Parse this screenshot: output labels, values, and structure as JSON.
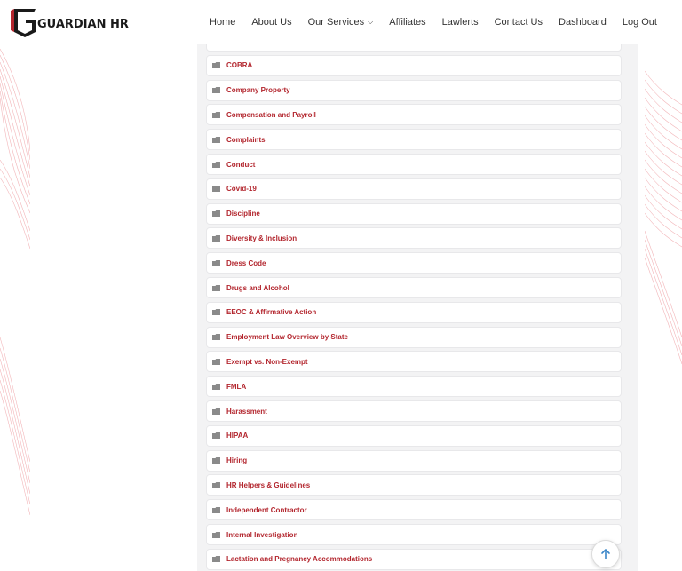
{
  "brand": {
    "name": "GUARDIAN HR",
    "accent_color": "#b3262e"
  },
  "nav": {
    "items": [
      {
        "label": "Home"
      },
      {
        "label": "About Us"
      },
      {
        "label": "Our Services",
        "has_dropdown": true
      },
      {
        "label": "Affiliates"
      },
      {
        "label": "Lawlerts"
      },
      {
        "label": "Contact Us"
      },
      {
        "label": "Dashboard"
      },
      {
        "label": "Log Out"
      }
    ]
  },
  "topics": {
    "icon": "folder-icon",
    "items": [
      {
        "label": ""
      },
      {
        "label": "COBRA"
      },
      {
        "label": "Company Property"
      },
      {
        "label": "Compensation and Payroll"
      },
      {
        "label": "Complaints"
      },
      {
        "label": "Conduct"
      },
      {
        "label": "Covid-19"
      },
      {
        "label": "Discipline"
      },
      {
        "label": "Diversity & Inclusion"
      },
      {
        "label": "Dress Code"
      },
      {
        "label": "Drugs and Alcohol"
      },
      {
        "label": "EEOC & Affirmative Action"
      },
      {
        "label": "Employment Law Overview by State"
      },
      {
        "label": "Exempt vs. Non-Exempt"
      },
      {
        "label": "FMLA"
      },
      {
        "label": "Harassment"
      },
      {
        "label": "HIPAA"
      },
      {
        "label": "Hiring"
      },
      {
        "label": "HR Helpers & Guidelines"
      },
      {
        "label": "Independent Contractor"
      },
      {
        "label": "Internal Investigation"
      },
      {
        "label": "Lactation and Pregnancy Accommodations"
      }
    ]
  },
  "scroll_top": {
    "icon": "arrow-up-icon"
  }
}
